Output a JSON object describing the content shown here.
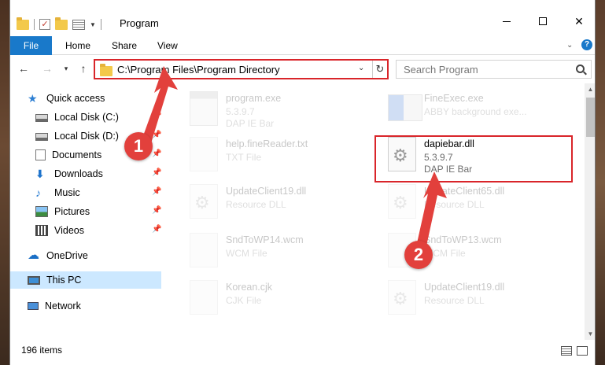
{
  "window": {
    "title": "Program",
    "minimize_glyph": "",
    "close_glyph": "✕"
  },
  "ribbon": {
    "tabs": [
      "File",
      "Home",
      "Share",
      "View"
    ]
  },
  "address": {
    "path": "C:\\Program Files\\Program Directory",
    "search_placeholder": "Search Program"
  },
  "nav_pane": {
    "items": [
      {
        "label": "Quick access",
        "icon": "star-icon",
        "pinned": false
      },
      {
        "label": "Local Disk (C:)",
        "icon": "drive-icon",
        "pinned": true
      },
      {
        "label": "Local Disk (D:)",
        "icon": "drive-icon",
        "pinned": true
      },
      {
        "label": "Documents",
        "icon": "documents-icon",
        "pinned": true
      },
      {
        "label": "Downloads",
        "icon": "download-icon",
        "pinned": true
      },
      {
        "label": "Music",
        "icon": "music-icon",
        "pinned": true
      },
      {
        "label": "Pictures",
        "icon": "pictures-icon",
        "pinned": true
      },
      {
        "label": "Videos",
        "icon": "videos-icon",
        "pinned": true
      },
      {
        "label": "OneDrive",
        "icon": "cloud-icon",
        "pinned": false
      },
      {
        "label": "This PC",
        "icon": "computer-icon",
        "pinned": false,
        "selected": true
      },
      {
        "label": "Network",
        "icon": "network-icon",
        "pinned": false
      }
    ]
  },
  "files": [
    {
      "name": "program.exe",
      "line1": "5.3.9.7",
      "line2": "DAP IE Bar",
      "icon": "exe-icon",
      "faded": true
    },
    {
      "name": "FineExec.exe",
      "line1": "ABBY background exe...",
      "line2": "",
      "icon": "app-icon",
      "faded": true
    },
    {
      "name": "help.fineReader.txt",
      "line1": "TXT File",
      "line2": "",
      "icon": "document-icon",
      "faded": true
    },
    {
      "name": "dapiebar.dll",
      "line1": "5.3.9.7",
      "line2": "DAP IE Bar",
      "icon": "dll-icon",
      "faded": false
    },
    {
      "name": "UpdateClient19.dll",
      "line1": "Resource DLL",
      "line2": "",
      "icon": "dll-icon",
      "faded": true
    },
    {
      "name": "UpdateClient65.dll",
      "line1": "Resource DLL",
      "line2": "",
      "icon": "dll-icon",
      "faded": true
    },
    {
      "name": "SndToWP14.wcm",
      "line1": "WCM File",
      "line2": "",
      "icon": "document-icon",
      "faded": true
    },
    {
      "name": "SndToWP13.wcm",
      "line1": "WCM File",
      "line2": "",
      "icon": "document-icon",
      "faded": true
    },
    {
      "name": "Korean.cjk",
      "line1": "CJK File",
      "line2": "",
      "icon": "document-icon",
      "faded": true
    },
    {
      "name": "UpdateClient19.dll",
      "line1": "Resource DLL",
      "line2": "",
      "icon": "dll-icon",
      "faded": true
    }
  ],
  "status": {
    "item_count": "196 items"
  },
  "annotations": {
    "step1": "1",
    "step2": "2",
    "color": "#e2403c"
  },
  "colors": {
    "accent": "#1979ca",
    "highlight": "#d9252a",
    "selected_bg": "#cce8ff"
  }
}
